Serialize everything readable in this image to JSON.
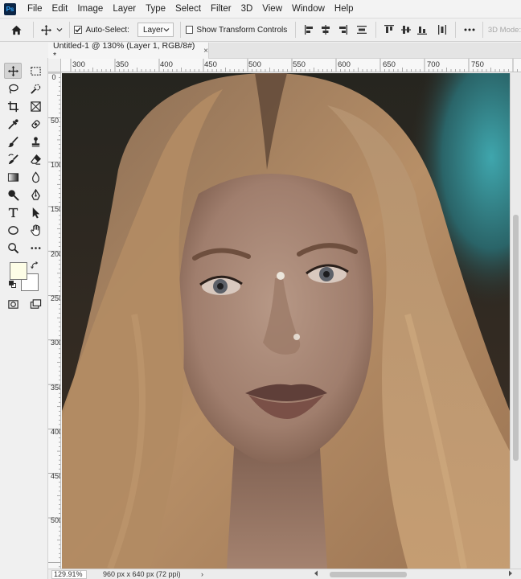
{
  "app": {
    "logo_text": "Ps",
    "accent": "#31a8ff"
  },
  "menu": {
    "items": [
      "File",
      "Edit",
      "Image",
      "Layer",
      "Type",
      "Select",
      "Filter",
      "3D",
      "View",
      "Window",
      "Help"
    ]
  },
  "options": {
    "auto_select_label": "Auto-Select:",
    "auto_select_checked": true,
    "layer_dropdown_value": "Layer",
    "show_transform_label": "Show Transform Controls",
    "show_transform_checked": false,
    "mode_3d_label": "3D Mode:"
  },
  "tab": {
    "title": "Untitled-1 @ 130% (Layer 1, RGB/8#) *",
    "close_label": "×"
  },
  "rulers": {
    "horizontal": [
      "300",
      "350",
      "400",
      "450",
      "500",
      "550",
      "600",
      "650",
      "700",
      "750"
    ],
    "vertical": [
      "0",
      "50",
      "100",
      "150",
      "200",
      "250",
      "300",
      "350",
      "400",
      "450",
      "500"
    ]
  },
  "colors": {
    "foreground": "#fdfde6",
    "background": "#ffffff"
  },
  "status": {
    "zoom": "129.91%",
    "doc_info": "960 px x 640 px (72 ppi)",
    "arrow": "›"
  },
  "canvas": {
    "content": "portrait photo"
  }
}
